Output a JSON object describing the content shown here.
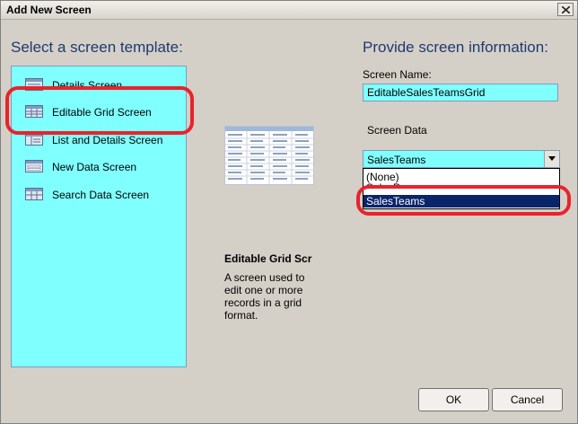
{
  "window": {
    "title": "Add New Screen"
  },
  "left": {
    "heading": "Select a screen template:",
    "templates": [
      {
        "label": "Details Screen",
        "icon": "details-screen-icon"
      },
      {
        "label": "Editable Grid Screen",
        "icon": "grid-screen-icon"
      },
      {
        "label": "List and Details Screen",
        "icon": "list-details-screen-icon"
      },
      {
        "label": "New Data Screen",
        "icon": "new-data-screen-icon"
      },
      {
        "label": "Search Data Screen",
        "icon": "search-data-screen-icon"
      }
    ],
    "list_background": "#80ffff"
  },
  "preview": {
    "title": "Editable Grid Scr",
    "description_lines": [
      "A screen used to",
      "edit one or more",
      "records in a grid",
      "format."
    ]
  },
  "right": {
    "heading": "Provide screen information:",
    "screen_name_label": "Screen Name:",
    "screen_name_value": "EditableSalesTeamsGrid",
    "screen_data_label": "Screen Data",
    "screen_data_selected": "SalesTeams",
    "options": [
      "(None)",
      "SalesPe...",
      "SalesTeams"
    ]
  },
  "buttons": {
    "ok": "OK",
    "cancel": "Cancel"
  },
  "colors": {
    "highlight": "#e8232b",
    "selection": "#0a246a",
    "heading": "#1f3a6e"
  }
}
